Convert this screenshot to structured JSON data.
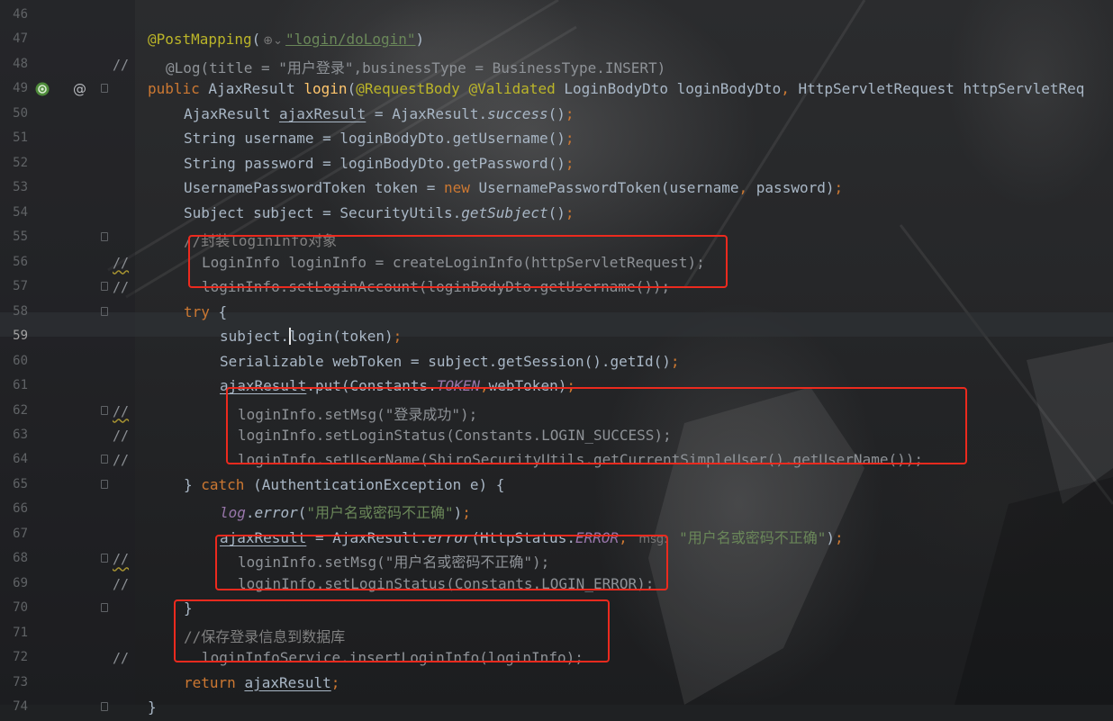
{
  "editor": {
    "lines": [
      {
        "num": "46",
        "prefix": "",
        "code": ""
      },
      {
        "num": "47",
        "prefix": "",
        "code": "@PostMapping(⊕⌄\"login/doLogin\")"
      },
      {
        "num": "48",
        "prefix": "//",
        "code": "@Log(title = \"用户登录\",businessType = BusinessType.INSERT)"
      },
      {
        "num": "49",
        "prefix": "",
        "code": "public AjaxResult login(@RequestBody @Validated LoginBodyDto loginBodyDto, HttpServletRequest httpServletReq"
      },
      {
        "num": "50",
        "prefix": "",
        "code": "AjaxResult ajaxResult = AjaxResult.success();"
      },
      {
        "num": "51",
        "prefix": "",
        "code": "String username = loginBodyDto.getUsername();"
      },
      {
        "num": "52",
        "prefix": "",
        "code": "String password = loginBodyDto.getPassword();"
      },
      {
        "num": "53",
        "prefix": "",
        "code": "UsernamePasswordToken token = new UsernamePasswordToken(username, password);"
      },
      {
        "num": "54",
        "prefix": "",
        "code": "Subject subject = SecurityUtils.getSubject();"
      },
      {
        "num": "55",
        "prefix": "",
        "code": "//封装loginInfo对象"
      },
      {
        "num": "56",
        "prefix": "//",
        "code": "LoginInfo loginInfo = createLoginInfo(httpServletRequest);"
      },
      {
        "num": "57",
        "prefix": "//",
        "code": "loginInfo.setLoginAccount(loginBodyDto.getUsername());"
      },
      {
        "num": "58",
        "prefix": "",
        "code": "try {"
      },
      {
        "num": "59",
        "prefix": "",
        "code": "subject.login(token);"
      },
      {
        "num": "60",
        "prefix": "",
        "code": "Serializable webToken = subject.getSession().getId();"
      },
      {
        "num": "61",
        "prefix": "",
        "code": "ajaxResult.put(Constants.TOKEN,webToken);"
      },
      {
        "num": "62",
        "prefix": "//",
        "code": "loginInfo.setMsg(\"登录成功\");"
      },
      {
        "num": "63",
        "prefix": "//",
        "code": "loginInfo.setLoginStatus(Constants.LOGIN_SUCCESS);"
      },
      {
        "num": "64",
        "prefix": "//",
        "code": "loginInfo.setUserName(ShiroSecurityUtils.getCurrentSimpleUser().getUserName());"
      },
      {
        "num": "65",
        "prefix": "",
        "code": "} catch (AuthenticationException e) {"
      },
      {
        "num": "66",
        "prefix": "",
        "code": "log.error(\"用户名或密码不正确\");"
      },
      {
        "num": "67",
        "prefix": "",
        "code": "ajaxResult = AjaxResult.error(HttpStatus.ERROR, msg: \"用户名或密码不正确\");"
      },
      {
        "num": "68",
        "prefix": "//",
        "code": "loginInfo.setMsg(\"用户名或密码不正确\");"
      },
      {
        "num": "69",
        "prefix": "//",
        "code": "loginInfo.setLoginStatus(Constants.LOGIN_ERROR);"
      },
      {
        "num": "70",
        "prefix": "",
        "code": "}"
      },
      {
        "num": "71",
        "prefix": "",
        "code": "//保存登录信息到数据库"
      },
      {
        "num": "72",
        "prefix": "//",
        "code": "loginInfoService.insertLoginInfo(loginInfo);"
      },
      {
        "num": "73",
        "prefix": "",
        "code": "return ajaxResult;"
      },
      {
        "num": "74",
        "prefix": "",
        "code": "}"
      }
    ],
    "current_line": "59",
    "param_hint": "msg:"
  },
  "gutter_icons": {
    "line_49": [
      "spring-bean-icon",
      "override-at-icon"
    ]
  },
  "colors": {
    "keyword": "#cc7832",
    "annotation": "#bbb529",
    "string": "#6a8759",
    "method": "#ffc66d",
    "field_constant": "#9876aa",
    "comment": "#808080",
    "highlight_box": "#ec2a1e"
  }
}
